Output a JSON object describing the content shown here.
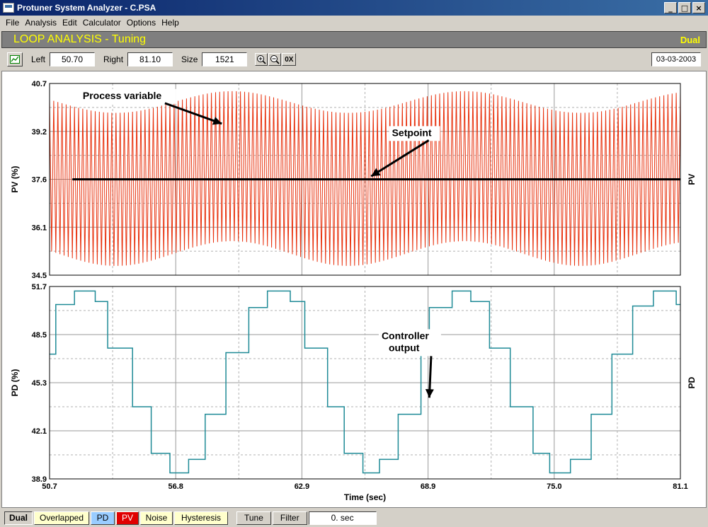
{
  "window": {
    "title": "Protuner System Analyzer - C.PSA",
    "minimize": "_",
    "maximize": "□",
    "close": "×"
  },
  "menu": [
    "File",
    "Analysis",
    "Edit",
    "Calculator",
    "Options",
    "Help"
  ],
  "header": {
    "title": "LOOP ANALYSIS - Tuning",
    "mode": "Dual"
  },
  "toolbar": {
    "left_label": "Left",
    "left_value": "50.70",
    "right_label": "Right",
    "right_value": "81.10",
    "size_label": "Size",
    "size_value": "1521",
    "zoom_in": "+",
    "zoom_out": "−",
    "zoom_reset": "0X",
    "date": "03-03-2003"
  },
  "bottom": {
    "tabs": [
      "Dual",
      "Overlapped",
      "PD",
      "PV",
      "Noise",
      "Hysteresis"
    ],
    "tune_label": "Tune",
    "filter_label": "Filter",
    "filter_value": "0. sec"
  },
  "colors": {
    "pv_trace": "#e8320e",
    "pd_trace": "#1e8a96",
    "setpoint": "#000000",
    "accent": "#ffff00"
  },
  "chart_data": [
    {
      "type": "line",
      "ylabel": "PV (%)",
      "right_label": "PV",
      "ylim": [
        34.5,
        40.7
      ],
      "yticks": [
        "40.7",
        "39.2",
        "37.6",
        "36.1",
        "34.5"
      ],
      "xlim": [
        50.7,
        81.1
      ],
      "series": [
        {
          "name": "PV",
          "kind": "oscillation",
          "center": 37.6,
          "high_base": 40.1,
          "high_amp": 0.35,
          "low_base": 35.2,
          "low_amp": 0.4,
          "slow_period": 11.2,
          "slow_phase_at": 59.5,
          "fast_period": 0.2
        },
        {
          "name": "Setpoint",
          "kind": "constant",
          "value": 37.6,
          "x": [
            51.8,
            81.1
          ]
        }
      ],
      "annotations": [
        {
          "text": "Process variable",
          "x": 52.3,
          "y": 40.2,
          "arrow_to": [
            59.0,
            39.4
          ]
        },
        {
          "text": "Setpoint",
          "x": 67.2,
          "y": 39.0,
          "arrow_to": [
            66.2,
            37.7
          ]
        }
      ]
    },
    {
      "type": "line",
      "ylabel": "PD (%)",
      "right_label": "PD",
      "xlabel": "Time (sec)",
      "ylim": [
        38.9,
        51.7
      ],
      "yticks": [
        "51.7",
        "48.5",
        "45.3",
        "42.1",
        "38.9"
      ],
      "xlim": [
        50.7,
        81.1
      ],
      "xticks": [
        "50.7",
        "56.8",
        "62.9",
        "68.9",
        "75.0",
        "81.1"
      ],
      "series": [
        {
          "name": "Controller output",
          "kind": "step",
          "x": [
            50.7,
            51.0,
            51.9,
            52.9,
            53.5,
            54.7,
            55.6,
            56.5,
            57.4,
            58.2,
            59.2,
            60.3,
            61.2,
            62.3,
            63.0,
            64.1,
            64.9,
            65.8,
            66.6,
            67.5,
            68.6,
            69.0,
            70.1,
            71.0,
            71.9,
            72.9,
            74.0,
            74.8,
            75.8,
            76.8,
            77.8,
            78.8,
            79.8,
            80.9,
            81.1
          ],
          "values": [
            47.2,
            50.5,
            51.4,
            50.7,
            47.6,
            43.7,
            40.6,
            39.3,
            40.2,
            43.2,
            47.3,
            50.3,
            51.4,
            50.7,
            47.6,
            43.7,
            40.6,
            39.3,
            40.2,
            43.2,
            47.3,
            50.3,
            51.4,
            50.7,
            47.6,
            43.7,
            40.6,
            39.3,
            40.2,
            43.2,
            47.2,
            50.4,
            51.4,
            50.5,
            50.5
          ]
        }
      ],
      "annotations": [
        {
          "text": "Controller output",
          "x": 66.7,
          "y": 48.2,
          "arrow_to": [
            69.0,
            44.3
          ]
        }
      ]
    }
  ]
}
